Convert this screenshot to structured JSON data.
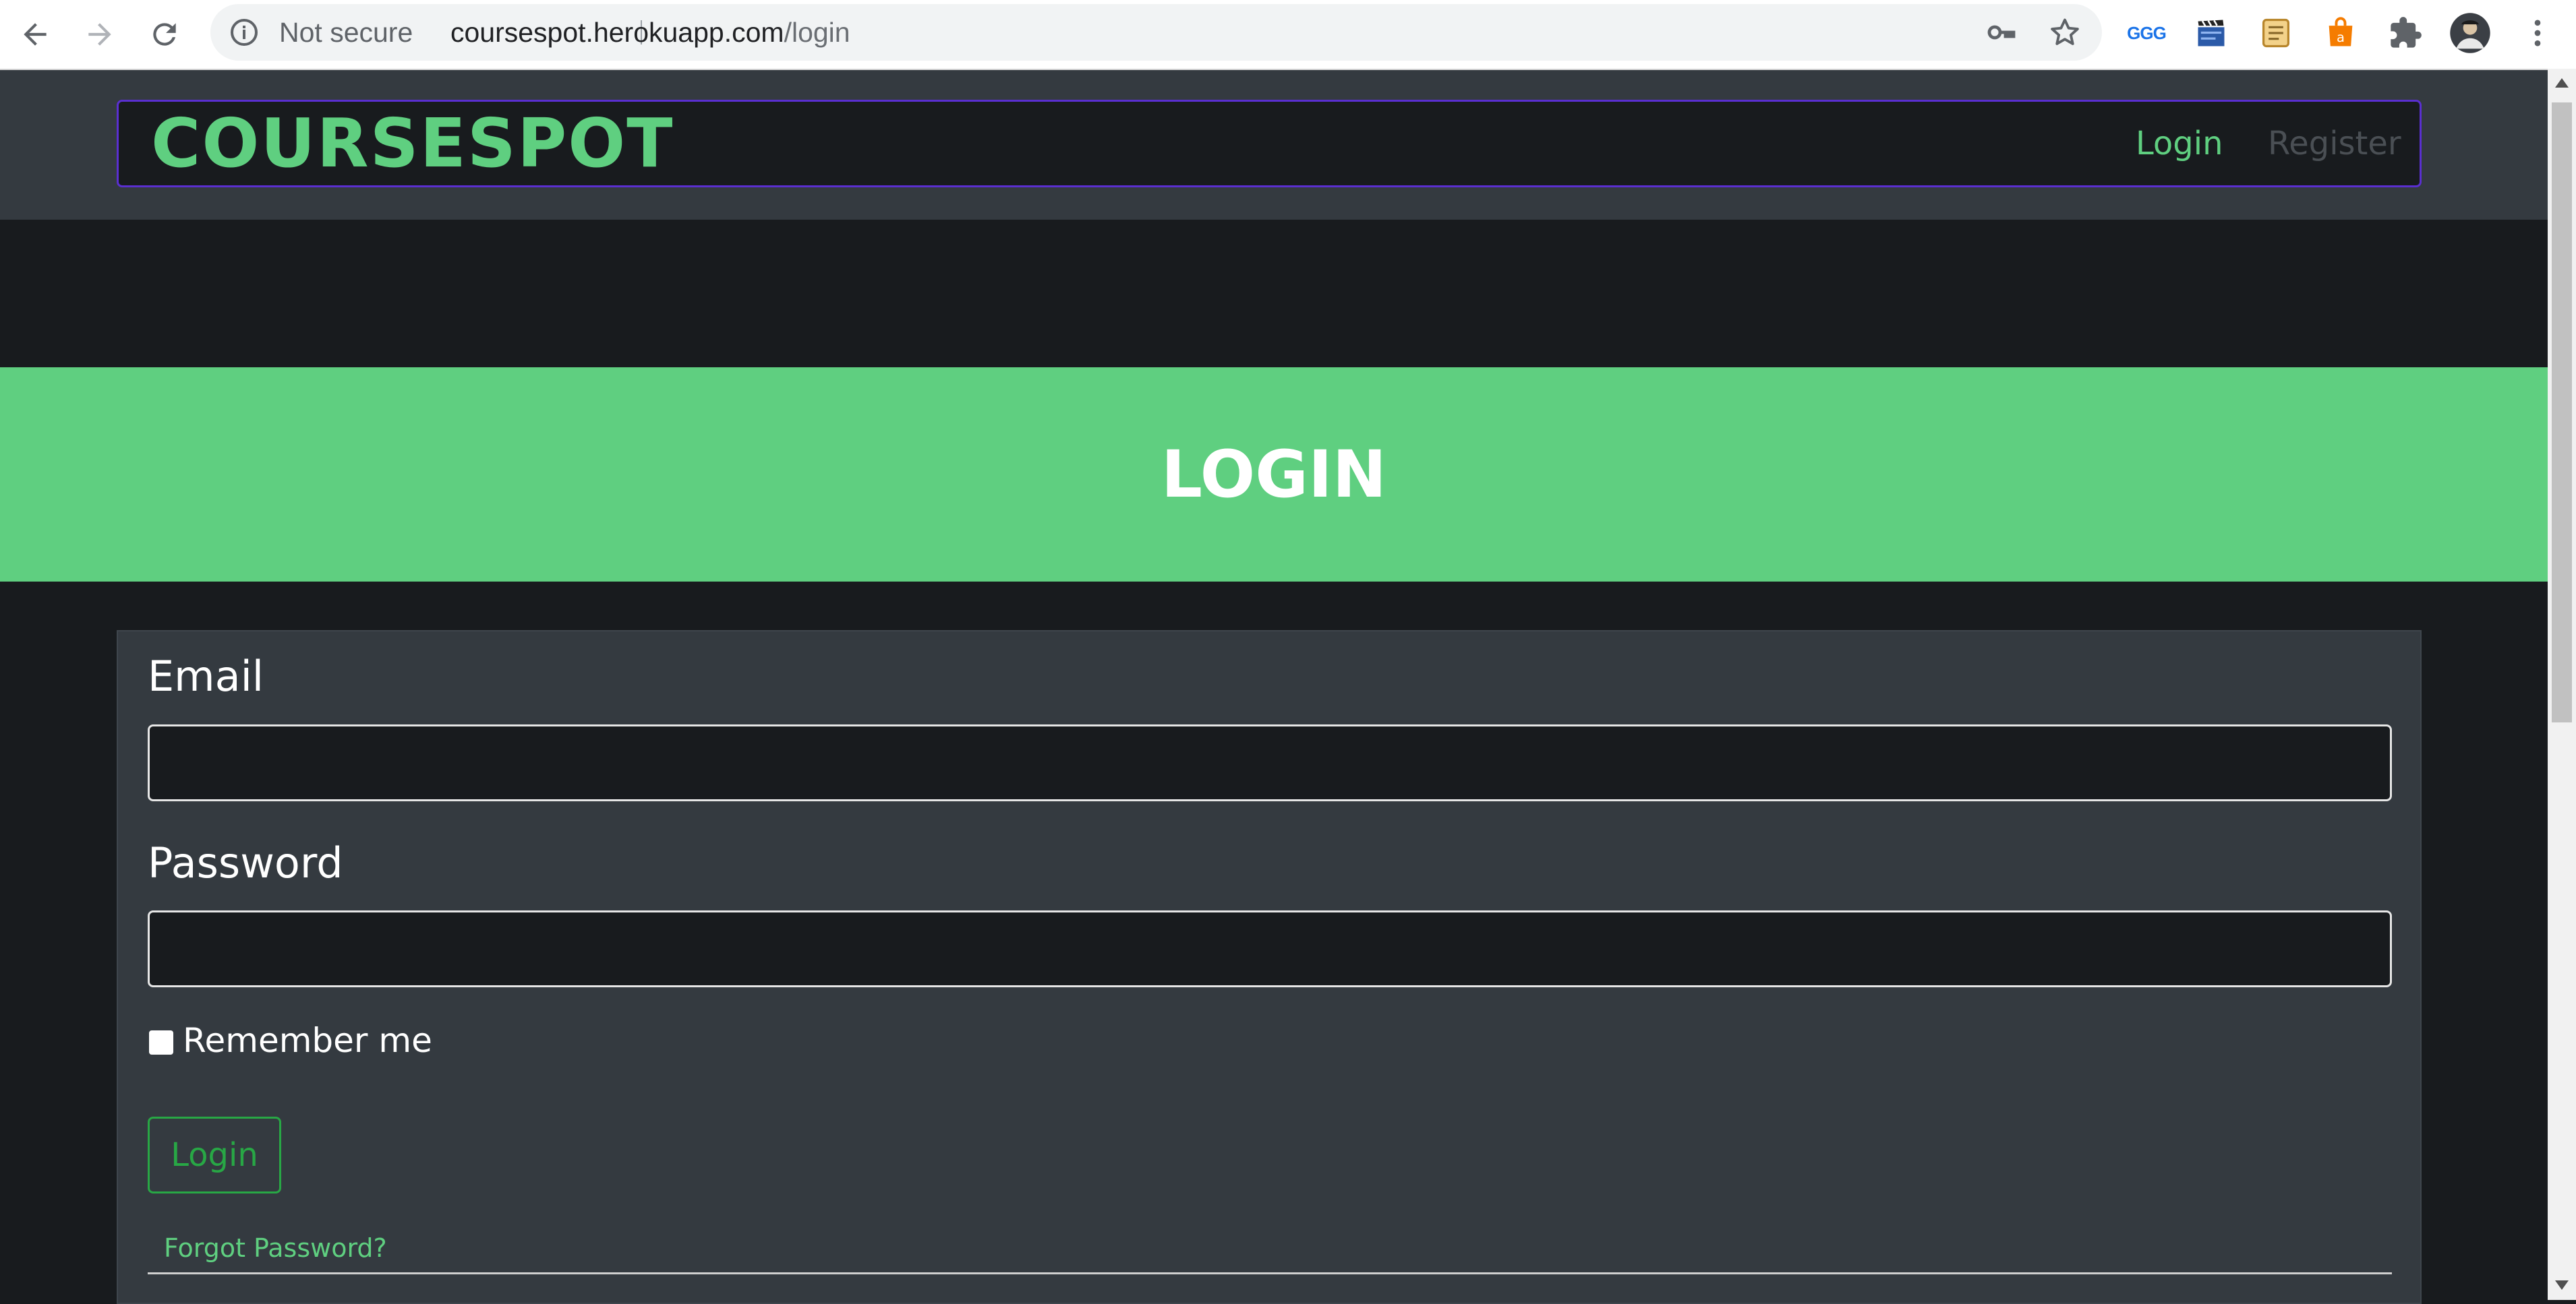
{
  "browser": {
    "security_label": "Not secure",
    "url_domain": "coursespot.herokuapp.com",
    "url_path": "/login",
    "icons": [
      "back-arrow-icon",
      "forward-arrow-icon",
      "reload-icon",
      "info-icon",
      "key-icon",
      "star-icon",
      "ggg-extension-icon",
      "clapperboard-extension-icon",
      "notes-extension-icon",
      "shopping-bag-extension-icon",
      "puzzle-extensions-icon",
      "profile-avatar",
      "kebab-menu-icon"
    ],
    "ggg_text": "GGG",
    "bag_text": "a"
  },
  "navbar": {
    "brand": "COURSESPOT",
    "links": [
      {
        "label": "Login",
        "active": true
      },
      {
        "label": "Register",
        "active": false
      }
    ]
  },
  "hero": {
    "title": "LOGIN"
  },
  "form": {
    "email_label": "Email",
    "email_value": "",
    "password_label": "Password",
    "password_value": "",
    "remember_label": "Remember me",
    "remember_checked": false,
    "submit_label": "Login",
    "forgot_label": "Forgot Password?"
  },
  "colors": {
    "brand_green": "#5fcf80",
    "button_green": "#28a745",
    "navbar_border": "#5a2fd0",
    "page_bg": "#181b1e",
    "panel_bg": "#343a40",
    "register_link": "#4a4f54"
  }
}
